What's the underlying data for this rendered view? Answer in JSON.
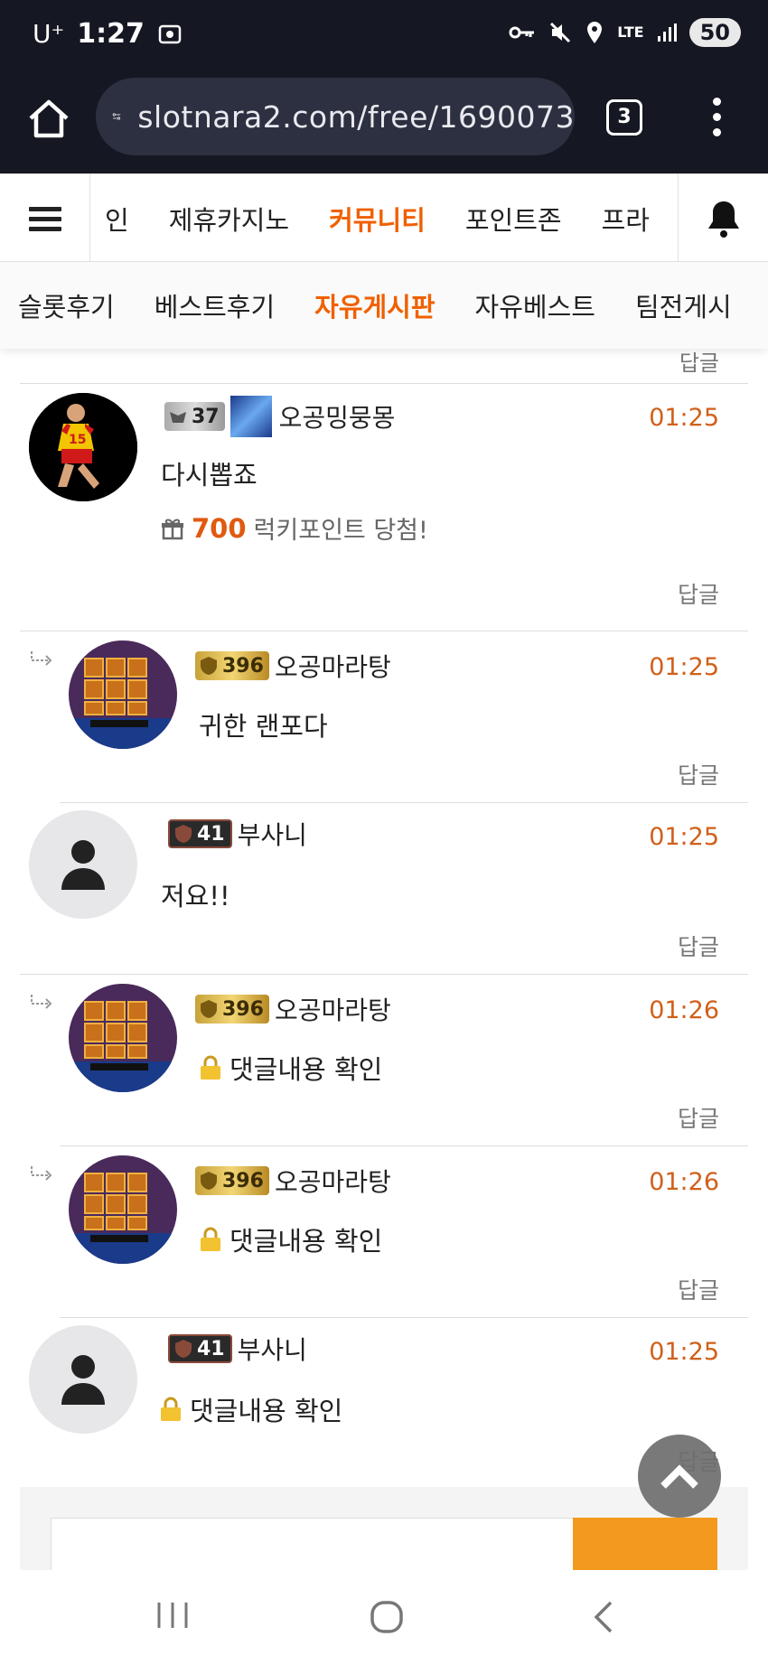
{
  "status_bar": {
    "carrier": "U⁺",
    "time": "1:27",
    "network": "LTE",
    "battery": "50"
  },
  "browser": {
    "url": "slotnara2.com/free/1690073",
    "tab_count": "3"
  },
  "nav_primary": {
    "items": [
      "인",
      "제휴카지노",
      "커뮤니티",
      "포인트존",
      "프라"
    ],
    "active": "커뮤니티"
  },
  "nav_secondary": {
    "items": [
      "슬롯후기",
      "베스트후기",
      "자유게시판",
      "자유베스트",
      "팀전게시"
    ],
    "active": "자유게시판"
  },
  "prev_reply_label": "답글",
  "comments": [
    {
      "level": "37",
      "nickname": "오공밍뭉몽",
      "time": "01:25",
      "text": "다시뽑죠",
      "lucky_points": "700",
      "lucky_text": "럭키포인트 당첨!",
      "reply_label": "답글"
    },
    {
      "level": "396",
      "nickname": "오공마라탕",
      "time": "01:25",
      "text": "귀한 랜포다",
      "reply_label": "답글"
    },
    {
      "level": "41",
      "nickname": "부사니",
      "time": "01:25",
      "text": "저요!!",
      "reply_label": "답글"
    },
    {
      "level": "396",
      "nickname": "오공마라탕",
      "time": "01:26",
      "text": "댓글내용 확인",
      "reply_label": "답글"
    },
    {
      "level": "396",
      "nickname": "오공마라탕",
      "time": "01:26",
      "text": "댓글내용 확인",
      "reply_label": "답글"
    },
    {
      "level": "41",
      "nickname": "부사니",
      "time": "01:25",
      "text": "댓글내용 확인",
      "reply_label": "답글"
    }
  ],
  "colors": {
    "accent": "#f06000",
    "time": "#d0601a",
    "browser_bg": "#151722",
    "submit_button": "#f39a1e"
  }
}
